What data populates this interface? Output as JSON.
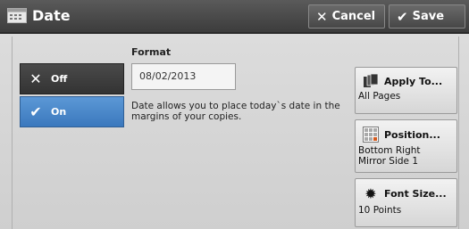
{
  "header": {
    "title": "Date",
    "cancel_label": "Cancel",
    "save_label": "Save"
  },
  "format": {
    "label": "Format",
    "value": "08/02/2013",
    "description": "Date allows you to place today`s date in the margins of your copies."
  },
  "options": [
    {
      "label": "Off",
      "icon": "x-icon",
      "selected": false
    },
    {
      "label": "On",
      "icon": "check-icon",
      "selected": true
    }
  ],
  "side_buttons": {
    "apply_to": {
      "label": "Apply To...",
      "value": "All Pages",
      "icon": "pages-icon"
    },
    "position": {
      "label": "Position...",
      "value_line1": "Bottom Right",
      "value_line2": "Mirror Side 1",
      "icon": "grid-position-icon"
    },
    "font_size": {
      "label": "Font Size...",
      "value": "10 Points",
      "icon": "gear-icon"
    }
  },
  "colors": {
    "header": "#474747",
    "selected": "#4a88cc",
    "background": "#d9d9d9"
  }
}
